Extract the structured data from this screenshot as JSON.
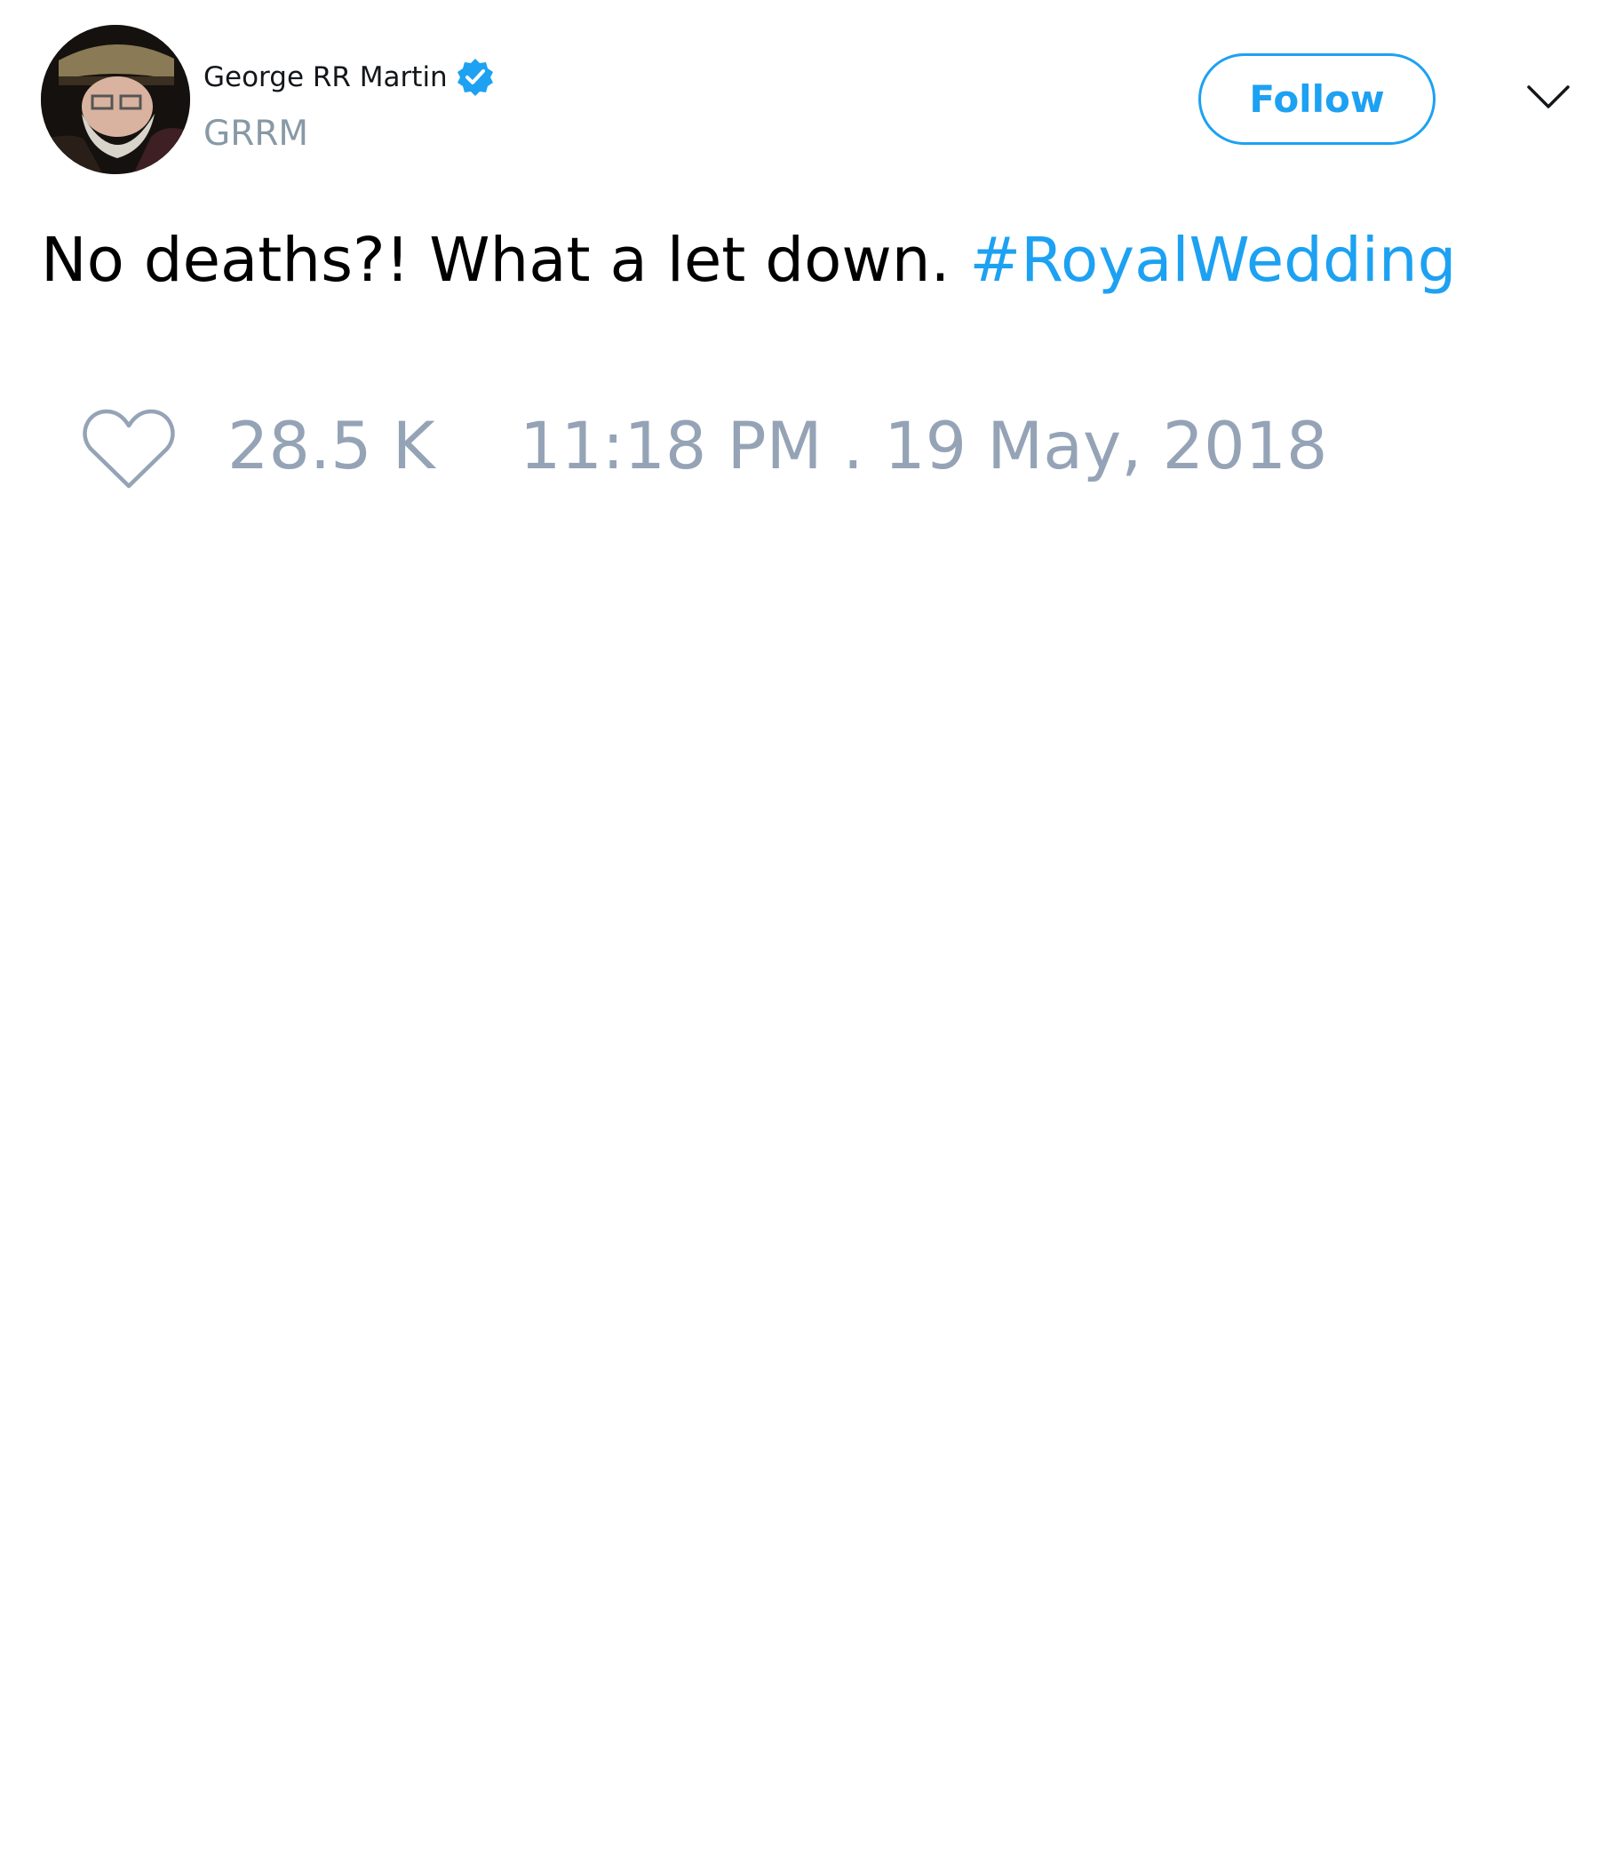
{
  "author": {
    "display_name": "George RR Martin",
    "handle": "GRRM",
    "verified": true,
    "avatar_icon": "profile-photo"
  },
  "header": {
    "follow_label": "Follow",
    "menu_icon": "chevron-down-icon"
  },
  "tweet": {
    "text": "No deaths?! What a let down.",
    "hashtag": "#RoyalWedding"
  },
  "stats": {
    "like_icon": "heart-icon",
    "likes": "28.5 K",
    "timestamp": "11:18 PM . 19 May, 2018"
  },
  "colors": {
    "accent": "#1da1f2",
    "muted": "#95a3b6",
    "text": "#000000"
  }
}
